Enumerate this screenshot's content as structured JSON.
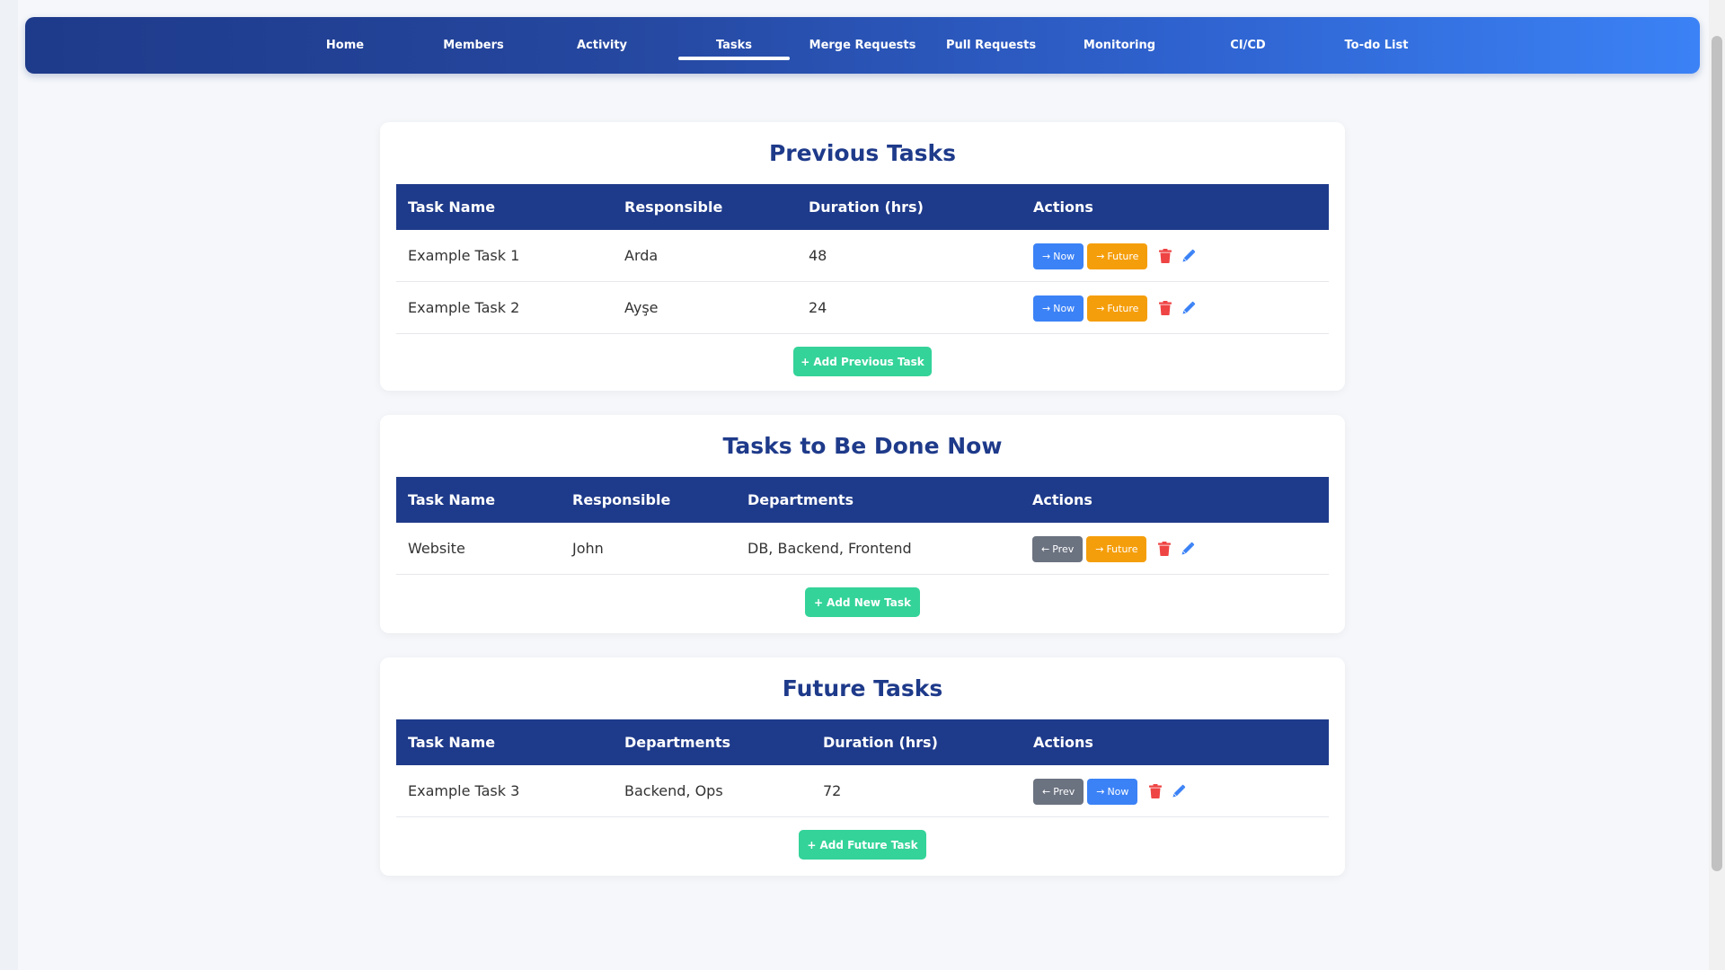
{
  "nav": {
    "items": [
      {
        "label": "Home"
      },
      {
        "label": "Members"
      },
      {
        "label": "Activity"
      },
      {
        "label": "Tasks"
      },
      {
        "label": "Merge Requests"
      },
      {
        "label": "Pull Requests"
      },
      {
        "label": "Monitoring"
      },
      {
        "label": "CI/CD"
      },
      {
        "label": "To-do List"
      }
    ],
    "active": "Tasks"
  },
  "icons": {
    "arrow_right": "→",
    "arrow_left": "←",
    "plus": "+",
    "trash": "trash-icon",
    "pencil": "pencil-icon"
  },
  "colors": {
    "brand": "#1e3a8a",
    "now": "#3b82f6",
    "future": "#f59e0b",
    "prev": "#6b7280",
    "add": "#34d399",
    "delete": "#ef4444",
    "edit": "#3b82f6"
  },
  "previous": {
    "title": "Previous Tasks",
    "columns": [
      "Task Name",
      "Responsible",
      "Duration (hrs)",
      "Actions"
    ],
    "rows": [
      {
        "name": "Example Task 1",
        "responsible": "Arda",
        "duration": "48"
      },
      {
        "name": "Example Task 2",
        "responsible": "Ayşe",
        "duration": "24"
      }
    ],
    "btn_now": "Now",
    "btn_future": "Future",
    "add_label": "Add Previous Task"
  },
  "now": {
    "title": "Tasks to Be Done Now",
    "columns": [
      "Task Name",
      "Responsible",
      "Departments",
      "Actions"
    ],
    "rows": [
      {
        "name": "Website",
        "responsible": "John",
        "departments": "DB, Backend, Frontend"
      }
    ],
    "btn_prev": "Prev",
    "btn_future": "Future",
    "add_label": "Add New Task"
  },
  "future": {
    "title": "Future Tasks",
    "columns": [
      "Task Name",
      "Departments",
      "Duration (hrs)",
      "Actions"
    ],
    "rows": [
      {
        "name": "Example Task 3",
        "departments": "Backend, Ops",
        "duration": "72"
      }
    ],
    "btn_prev": "Prev",
    "btn_now": "Now",
    "add_label": "Add Future Task"
  }
}
